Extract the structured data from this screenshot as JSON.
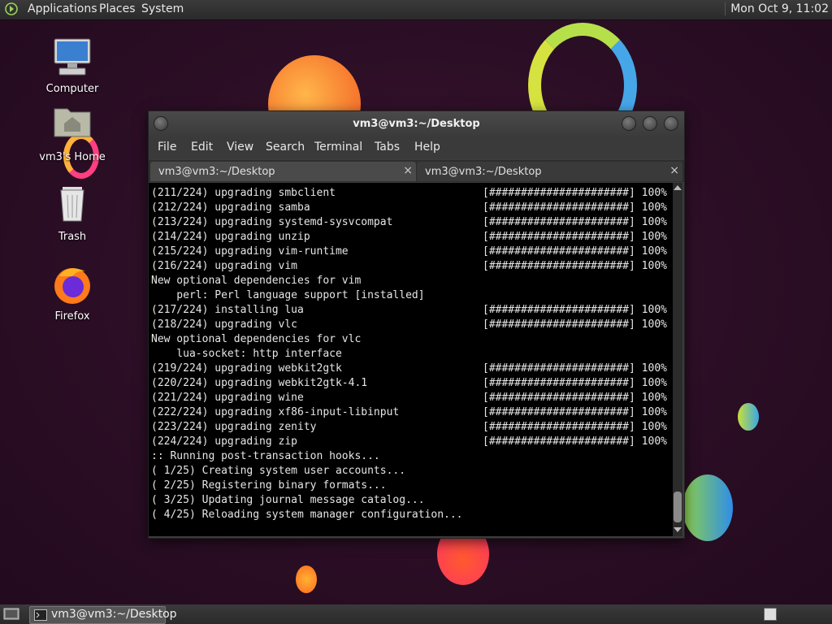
{
  "top_panel": {
    "menus": [
      "Applications",
      "Places",
      "System"
    ],
    "clock": "Mon Oct 9, 11:02"
  },
  "desktop_icons": [
    {
      "label": "Computer",
      "icon": "computer-icon"
    },
    {
      "label": "vm3's Home",
      "icon": "home-folder-icon"
    },
    {
      "label": "Trash",
      "icon": "trash-icon"
    },
    {
      "label": "Firefox",
      "icon": "firefox-icon"
    }
  ],
  "window": {
    "title": "vm3@vm3:~/Desktop",
    "menus": [
      "File",
      "Edit",
      "View",
      "Search",
      "Terminal",
      "Tabs",
      "Help"
    ],
    "tabs": [
      {
        "label": "vm3@vm3:~/Desktop",
        "close": "×"
      },
      {
        "label": "vm3@vm3:~/Desktop",
        "close": "×"
      }
    ]
  },
  "terminal": {
    "lines": [
      {
        "text": "(211/224) upgrading smbclient",
        "progress": "[######################] 100%"
      },
      {
        "text": "(212/224) upgrading samba",
        "progress": "[######################] 100%"
      },
      {
        "text": "(213/224) upgrading systemd-sysvcompat",
        "progress": "[######################] 100%"
      },
      {
        "text": "(214/224) upgrading unzip",
        "progress": "[######################] 100%"
      },
      {
        "text": "(215/224) upgrading vim-runtime",
        "progress": "[######################] 100%"
      },
      {
        "text": "(216/224) upgrading vim",
        "progress": "[######################] 100%"
      },
      {
        "text": "New optional dependencies for vim",
        "progress": ""
      },
      {
        "text": "    perl: Perl language support [installed]",
        "progress": ""
      },
      {
        "text": "(217/224) installing lua",
        "progress": "[######################] 100%"
      },
      {
        "text": "(218/224) upgrading vlc",
        "progress": "[######################] 100%"
      },
      {
        "text": "New optional dependencies for vlc",
        "progress": ""
      },
      {
        "text": "    lua-socket: http interface",
        "progress": ""
      },
      {
        "text": "(219/224) upgrading webkit2gtk",
        "progress": "[######################] 100%"
      },
      {
        "text": "(220/224) upgrading webkit2gtk-4.1",
        "progress": "[######################] 100%"
      },
      {
        "text": "(221/224) upgrading wine",
        "progress": "[######################] 100%"
      },
      {
        "text": "(222/224) upgrading xf86-input-libinput",
        "progress": "[######################] 100%"
      },
      {
        "text": "(223/224) upgrading zenity",
        "progress": "[######################] 100%"
      },
      {
        "text": "(224/224) upgrading zip",
        "progress": "[######################] 100%"
      },
      {
        "text": ":: Running post-transaction hooks...",
        "progress": ""
      },
      {
        "text": "( 1/25) Creating system user accounts...",
        "progress": ""
      },
      {
        "text": "( 2/25) Registering binary formats...",
        "progress": ""
      },
      {
        "text": "( 3/25) Updating journal message catalog...",
        "progress": ""
      },
      {
        "text": "( 4/25) Reloading system manager configuration...",
        "progress": ""
      }
    ]
  },
  "bottom_panel": {
    "task": "vm3@vm3:~/Desktop"
  },
  "colors": {
    "terminal_bg": "#000000",
    "terminal_fg": "#e6e6e6",
    "panel_bg": "#2f2f2f",
    "desktop_bg": "#2b0e25"
  }
}
